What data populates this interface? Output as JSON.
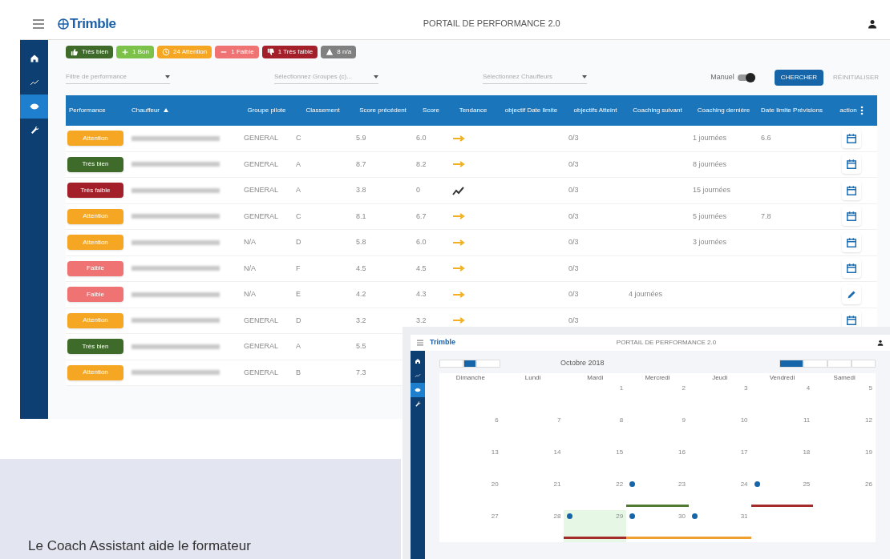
{
  "header": {
    "logo": "Trimble",
    "title": "PORTAIL DE PERFORMANCE 2.0"
  },
  "sidebar": {
    "items": [
      {
        "kind": "home",
        "selected": false
      },
      {
        "kind": "trend",
        "selected": false
      },
      {
        "kind": "eye",
        "selected": true
      },
      {
        "kind": "wrench",
        "selected": false
      }
    ]
  },
  "summary_chips": [
    {
      "kind": "thumbs_up",
      "label": "Très bien",
      "color": "#3f6b2a"
    },
    {
      "kind": "plus",
      "label": "1 Bon",
      "color": "#7cc24a"
    },
    {
      "kind": "clock",
      "label": "24 Attention",
      "color": "#f5a623"
    },
    {
      "kind": "minus",
      "label": "1 Faible",
      "color": "#f07373"
    },
    {
      "kind": "thumbs_down",
      "label": "1 Très faible",
      "color": "#a3202a"
    },
    {
      "kind": "warning",
      "label": "8 n/a",
      "color": "#808080"
    }
  ],
  "filters": [
    {
      "placeholder": "Filtre de performance"
    },
    {
      "placeholder": "Sélectionnez Groupes (c)..."
    },
    {
      "placeholder": "Sélectionnez Chauffeurs"
    }
  ],
  "manual_toggle": {
    "label": "Manuel",
    "on": true
  },
  "search_button": "CHERCHER",
  "reset_link": "RÉINITIALISER",
  "table": {
    "columns": [
      {
        "label": "Performance",
        "sorted": false
      },
      {
        "label": "Chauffeur",
        "sorted": true
      },
      {
        "label": "Groupe pilote",
        "sorted": false
      },
      {
        "label": "Classement",
        "sorted": false
      },
      {
        "label": "Score précédent",
        "sorted": false
      },
      {
        "label": "Score",
        "sorted": false
      },
      {
        "label": "Tendance",
        "sorted": false
      },
      {
        "label": "objectif Date limite",
        "sorted": false
      },
      {
        "label": "objectifs Atteint",
        "sorted": false
      },
      {
        "label": "Coaching suivant",
        "sorted": false
      },
      {
        "label": "Coaching dernière",
        "sorted": false
      },
      {
        "label": "Date limite Prévisions",
        "sorted": false
      },
      {
        "label": "action",
        "sorted": false
      }
    ],
    "rows": [
      {
        "performance": {
          "label": "Attention",
          "color": "#f5a623"
        },
        "groupe": "GENERAL",
        "classement": "C",
        "score_precedent": "5.9",
        "score": "6.0",
        "tendance": {
          "kind": "flat"
        },
        "objectifs_atteint": "0/3",
        "coaching_derniere": "1 journées",
        "date_limite": "6.6",
        "action": {
          "kind": "calendar"
        }
      },
      {
        "performance": {
          "label": "Très bien",
          "color": "#3f6b2a"
        },
        "groupe": "GENERAL",
        "classement": "A",
        "score_precedent": "8.7",
        "score": "8.2",
        "tendance": {
          "kind": "flat"
        },
        "objectifs_atteint": "0/3",
        "coaching_derniere": "8 journées",
        "action": {
          "kind": "calendar"
        }
      },
      {
        "performance": {
          "label": "Très faible",
          "color": "#a3202a"
        },
        "groupe": "GENERAL",
        "classement": "A",
        "score_precedent": "3.8",
        "score": "0",
        "tendance": {
          "kind": "up"
        },
        "objectifs_atteint": "0/3",
        "coaching_derniere": "15 journées",
        "action": {
          "kind": "calendar"
        }
      },
      {
        "performance": {
          "label": "Attention",
          "color": "#f5a623"
        },
        "groupe": "GENERAL",
        "classement": "C",
        "score_precedent": "8.1",
        "score": "6.7",
        "tendance": {
          "kind": "flat"
        },
        "objectifs_atteint": "0/3",
        "coaching_derniere": "5 journées",
        "date_limite": "7.8",
        "action": {
          "kind": "calendar"
        }
      },
      {
        "performance": {
          "label": "Attention",
          "color": "#f5a623"
        },
        "groupe": "N/A",
        "classement": "D",
        "score_precedent": "5.8",
        "score": "6.0",
        "tendance": {
          "kind": "flat"
        },
        "objectifs_atteint": "0/3",
        "coaching_derniere": "3 journées",
        "action": {
          "kind": "calendar"
        }
      },
      {
        "performance": {
          "label": "Faible",
          "color": "#f07373"
        },
        "groupe": "N/A",
        "classement": "F",
        "score_precedent": "4.5",
        "score": "4.5",
        "tendance": {
          "kind": "flat"
        },
        "objectifs_atteint": "0/3",
        "action": {
          "kind": "calendar"
        }
      },
      {
        "performance": {
          "label": "Faible",
          "color": "#f07373"
        },
        "groupe": "N/A",
        "classement": "E",
        "score_precedent": "4.2",
        "score": "4.3",
        "tendance": {
          "kind": "flat"
        },
        "objectifs_atteint": "0/3",
        "coaching_suivant": "4 journées",
        "action": {
          "kind": "edit"
        }
      },
      {
        "performance": {
          "label": "Attention",
          "color": "#f5a623"
        },
        "groupe": "GENERAL",
        "classement": "D",
        "score_precedent": "3.2",
        "score": "3.2",
        "tendance": {
          "kind": "flat"
        },
        "objectifs_atteint": "0/3",
        "action": {
          "kind": "calendar"
        }
      },
      {
        "performance": {
          "label": "Très bien",
          "color": "#3f6b2a"
        },
        "groupe": "GENERAL",
        "classement": "A",
        "score_precedent": "5.5"
      },
      {
        "performance": {
          "label": "Attention",
          "color": "#f5a623"
        },
        "groupe": "GENERAL",
        "classement": "B",
        "score_precedent": "7.3"
      }
    ]
  },
  "caption": "Le Coach Assistant aide le formateur",
  "calendar": {
    "logo": "Trimble",
    "title": "PORTAIL DE PERFORMANCE 2.0",
    "month": "Octobre 2018",
    "nav_buttons": [
      {
        "selected": false
      },
      {
        "selected": true
      },
      {
        "selected": false
      }
    ],
    "view_buttons": [
      {
        "selected": true
      },
      {
        "selected": false
      },
      {
        "selected": false
      },
      {
        "selected": false
      }
    ],
    "weekdays": [
      "Dimanche",
      "Lundi",
      "Mardi",
      "Mercredi",
      "Jeudi",
      "Vendredi",
      "Samedi"
    ],
    "weeks": [
      [
        {
          "kind": "empty"
        },
        {
          "kind": "empty"
        },
        {
          "kind": "day",
          "day": "1"
        },
        {
          "kind": "day",
          "day": "2"
        },
        {
          "kind": "day",
          "day": "3"
        },
        {
          "kind": "day",
          "day": "4"
        },
        {
          "kind": "day",
          "day": "5"
        }
      ],
      [
        {
          "kind": "day",
          "day": "6"
        },
        {
          "kind": "day",
          "day": "7"
        },
        {
          "kind": "day",
          "day": "8"
        },
        {
          "kind": "day",
          "day": "9"
        },
        {
          "kind": "day",
          "day": "10"
        },
        {
          "kind": "day",
          "day": "11"
        },
        {
          "kind": "day",
          "day": "12"
        }
      ],
      [
        {
          "kind": "day",
          "day": "13"
        },
        {
          "kind": "day",
          "day": "14"
        },
        {
          "kind": "day",
          "day": "15"
        },
        {
          "kind": "day",
          "day": "16"
        },
        {
          "kind": "day",
          "day": "17"
        },
        {
          "kind": "day",
          "day": "18"
        },
        {
          "kind": "day",
          "day": "19"
        }
      ],
      [
        {
          "kind": "day",
          "day": "20"
        },
        {
          "kind": "day",
          "day": "21"
        },
        {
          "kind": "day",
          "day": "22"
        },
        {
          "kind": "day",
          "day": "23",
          "marker": true,
          "event": {
            "color": "#4f7a32"
          }
        },
        {
          "kind": "day",
          "day": "24"
        },
        {
          "kind": "day",
          "day": "25",
          "marker": true,
          "event": {
            "color": "#a52a2a"
          }
        },
        {
          "kind": "day",
          "day": "26"
        }
      ],
      [
        {
          "kind": "day",
          "day": "27"
        },
        {
          "kind": "day",
          "day": "28"
        },
        {
          "kind": "day",
          "day": "29",
          "today": true,
          "marker": true,
          "event": {
            "color": "#a52a2a"
          }
        },
        {
          "kind": "day",
          "day": "30",
          "marker": true,
          "event": {
            "color": "#f0a030"
          }
        },
        {
          "kind": "day",
          "day": "31",
          "marker": true,
          "event": {
            "color": "#f0a030"
          }
        },
        {
          "kind": "empty"
        },
        {
          "kind": "empty"
        }
      ]
    ]
  }
}
